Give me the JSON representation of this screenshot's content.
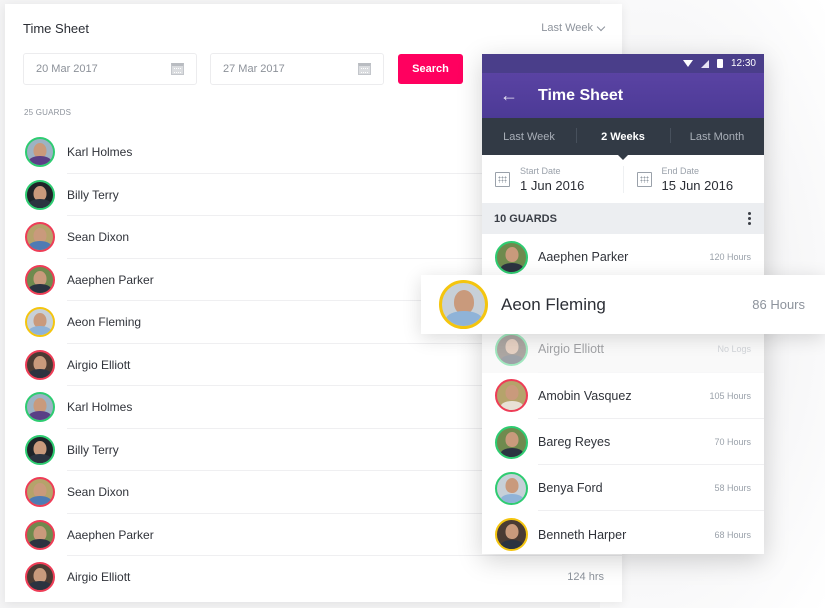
{
  "desktop": {
    "title": "Time Sheet",
    "range_dropdown": "Last Week",
    "start_date": "20 Mar 2017",
    "end_date": "27 Mar 2017",
    "search_label": "Search",
    "guards_count": "25 GUARDS",
    "guards": [
      {
        "name": "Karl Holmes",
        "hours": "",
        "ring": "green"
      },
      {
        "name": "Billy Terry",
        "hours": "",
        "ring": "green"
      },
      {
        "name": "Sean Dixon",
        "hours": "",
        "ring": "red"
      },
      {
        "name": "Aaephen Parker",
        "hours": "",
        "ring": "red"
      },
      {
        "name": "Aeon Fleming",
        "hours": "",
        "ring": "yellow"
      },
      {
        "name": "Airgio Elliott",
        "hours": "",
        "ring": "red"
      },
      {
        "name": "Karl Holmes",
        "hours": "",
        "ring": "green"
      },
      {
        "name": "Billy Terry",
        "hours": "",
        "ring": "green"
      },
      {
        "name": "Sean Dixon",
        "hours": "",
        "ring": "red"
      },
      {
        "name": "Aaephen Parker",
        "hours": "",
        "ring": "red"
      },
      {
        "name": "Airgio Elliott",
        "hours": "124 hrs",
        "ring": "red"
      }
    ]
  },
  "mobile": {
    "status_time": "12:30",
    "title": "Time Sheet",
    "tabs": [
      {
        "label": "Last Week",
        "active": false
      },
      {
        "label": "2 Weeks",
        "active": true
      },
      {
        "label": "Last Month",
        "active": false
      }
    ],
    "start_label": "Start Date",
    "start_value": "1 Jun 2016",
    "end_label": "End Date",
    "end_value": "15 Jun 2016",
    "guards_count": "10 GUARDS",
    "guards": [
      {
        "name": "Aaephen Parker",
        "hours": "120 Hours",
        "ring": "green"
      },
      {
        "name": "Aeon Fleming",
        "hours": "86 Hours",
        "ring": "yellow"
      },
      {
        "name": "Airgio Elliott",
        "hours": "No Logs",
        "ring": "green"
      },
      {
        "name": "Amobin Vasquez",
        "hours": "105 Hours",
        "ring": "red"
      },
      {
        "name": "Bareg Reyes",
        "hours": "70 Hours",
        "ring": "green"
      },
      {
        "name": "Benya Ford",
        "hours": "58 Hours",
        "ring": "green"
      },
      {
        "name": "Benneth Harper",
        "hours": "68 Hours",
        "ring": "yellow"
      }
    ]
  },
  "highlight": {
    "name": "Aeon Fleming",
    "hours": "86 Hours"
  },
  "colors": {
    "accent": "#ff005f",
    "appbar": "#5a43a3",
    "statusbar": "#4a3e8a",
    "tabbar": "#323a45",
    "ring_green": "#2ecc71",
    "ring_red": "#ee3d57",
    "ring_yellow": "#f4c50f"
  }
}
